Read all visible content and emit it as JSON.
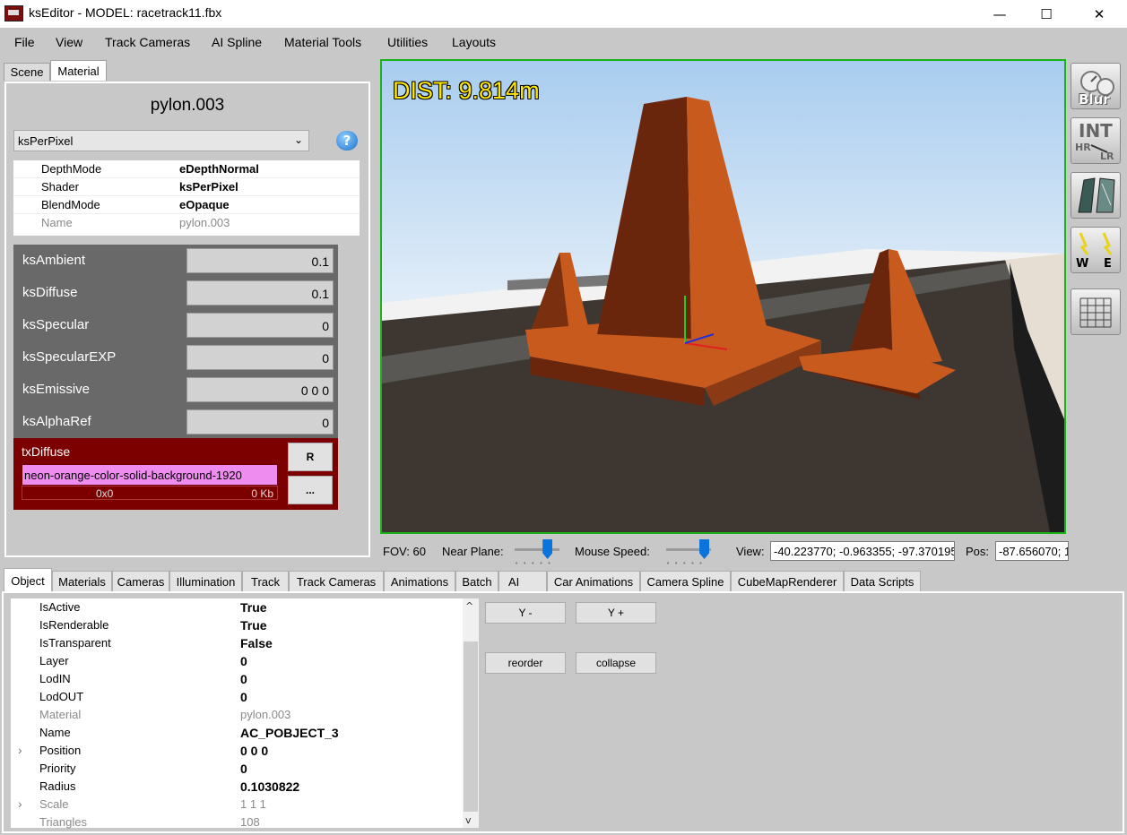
{
  "window": {
    "title": "ksEditor - MODEL: racetrack11.fbx",
    "minimize": "—",
    "maximize": "☐",
    "close": "✕"
  },
  "menu": [
    "File",
    "View",
    "Track Cameras",
    "AI Spline",
    "Material Tools",
    "Utilities",
    "Layouts"
  ],
  "left_tabs": [
    "Scene",
    "Material"
  ],
  "material": {
    "title": "pylon.003",
    "shader_select": "ksPerPixel",
    "help_label": "?",
    "properties": [
      {
        "key": "DepthMode",
        "value": "eDepthNormal"
      },
      {
        "key": "Shader",
        "value": "ksPerPixel"
      },
      {
        "key": "BlendMode",
        "value": "eOpaque"
      },
      {
        "key": "Name",
        "value": "pylon.003"
      }
    ],
    "ks_values": [
      {
        "label": "ksAmbient",
        "value": "0.1"
      },
      {
        "label": "ksDiffuse",
        "value": "0.1"
      },
      {
        "label": "ksSpecular",
        "value": "0"
      },
      {
        "label": "ksSpecularEXP",
        "value": "0"
      },
      {
        "label": "ksEmissive",
        "value": "0 0 0"
      },
      {
        "label": "ksAlphaRef",
        "value": "0"
      }
    ],
    "texture": {
      "label": "txDiffuse",
      "file": "neon-orange-color-solid-background-1920",
      "dimensions": "0x0",
      "size": "0 Kb",
      "reload_button": "R",
      "browse_button": "..."
    }
  },
  "viewport": {
    "distance_readout": "DIST: 9.814m",
    "colors": {
      "sky": "#cfe3f5",
      "ground": "#3a332d",
      "cone": "#c85a1e",
      "border": "#19b219"
    }
  },
  "toolbar": {
    "blur_label": "Blur",
    "int_label": "INT",
    "hr_label": "HR",
    "lr_label": "LR",
    "w_label": "W",
    "e_label": "E"
  },
  "fovbar": {
    "fov": "FOV: 60",
    "near_plane_label": "Near Plane:",
    "near_plane_level": 0.8,
    "mouse_speed_label": "Mouse Speed:",
    "mouse_speed_level": 0.95,
    "view_label": "View:",
    "view_value": "-40.223770; -0.963355; -97.370195",
    "pos_label": "Pos:",
    "pos_value": "-87.656070; 1"
  },
  "bottom_tabs": [
    "Object",
    "Materials",
    "Cameras",
    "Illumination",
    "Track",
    "Track Cameras",
    "Animations",
    "Batch",
    "AI",
    "Car Animations",
    "Camera Spline",
    "CubeMapRenderer",
    "Data Scripts"
  ],
  "object_props": [
    {
      "key": "IsActive",
      "value": "True",
      "gray": false,
      "expandable": false
    },
    {
      "key": "IsRenderable",
      "value": "True",
      "gray": false,
      "expandable": false
    },
    {
      "key": "IsTransparent",
      "value": "False",
      "gray": false,
      "expandable": false
    },
    {
      "key": "Layer",
      "value": "0",
      "gray": false,
      "expandable": false
    },
    {
      "key": "LodIN",
      "value": "0",
      "gray": false,
      "expandable": false
    },
    {
      "key": "LodOUT",
      "value": "0",
      "gray": false,
      "expandable": false
    },
    {
      "key": "Material",
      "value": "pylon.003",
      "gray": true,
      "expandable": false
    },
    {
      "key": "Name",
      "value": "AC_POBJECT_3",
      "gray": false,
      "expandable": false
    },
    {
      "key": "Position",
      "value": "0 0 0",
      "gray": false,
      "expandable": true
    },
    {
      "key": "Priority",
      "value": "0",
      "gray": false,
      "expandable": false
    },
    {
      "key": "Radius",
      "value": "0.1030822",
      "gray": false,
      "expandable": false
    },
    {
      "key": "Scale",
      "value": "1 1 1",
      "gray": true,
      "expandable": true
    },
    {
      "key": "Triangles",
      "value": "108",
      "gray": true,
      "expandable": false
    }
  ],
  "object_buttons": {
    "y_minus": "Y -",
    "y_plus": "Y +",
    "reorder": "reorder",
    "collapse": "collapse"
  },
  "scroll": {
    "up": "^",
    "down": "v"
  }
}
